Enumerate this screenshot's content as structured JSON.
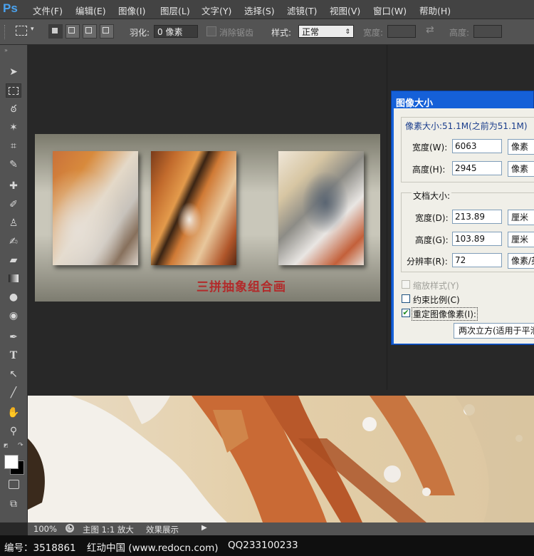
{
  "app": {
    "logo": "Ps"
  },
  "menu": [
    "文件(F)",
    "编辑(E)",
    "图像(I)",
    "图层(L)",
    "文字(Y)",
    "选择(S)",
    "滤镜(T)",
    "视图(V)",
    "窗口(W)",
    "帮助(H)"
  ],
  "options": {
    "feather_label": "羽化:",
    "feather_value": "0 像素",
    "antialias_label": "消除锯齿",
    "style_label": "样式:",
    "style_value": "正常",
    "width_label": "宽度:",
    "height_label": "高度:"
  },
  "thumbnail": {
    "caption": "三拼抽象组合画"
  },
  "dialog": {
    "title": "图像大小",
    "pixel_size": "像素大小:51.1M(之前为51.1M)",
    "width_label": "宽度(W):",
    "width_value": "6063",
    "width_unit": "像素",
    "height_label": "高度(H):",
    "height_value": "2945",
    "height_unit": "像素",
    "doc_size_label": "文档大小:",
    "doc_width_label": "宽度(D):",
    "doc_width_value": "213.89",
    "doc_width_unit": "厘米",
    "doc_height_label": "高度(G):",
    "doc_height_value": "103.89",
    "doc_height_unit": "厘米",
    "resolution_label": "分辨率(R):",
    "resolution_value": "72",
    "resolution_unit": "像素/英寸",
    "scale_styles": "缩放样式(Y)",
    "constrain": "约束比例(C)",
    "resample": "重定图像像素(I):",
    "resample_method": "两次立方(适用于平滑渐变)"
  },
  "status": {
    "zoom": "100%",
    "doc_label": "主图 1:1 放大",
    "tab_label": "效果展示"
  },
  "footer": {
    "id_label": "编号：3518861",
    "site": "红动中国 (www.redocn.com)",
    "qq": "QQ233100233"
  }
}
